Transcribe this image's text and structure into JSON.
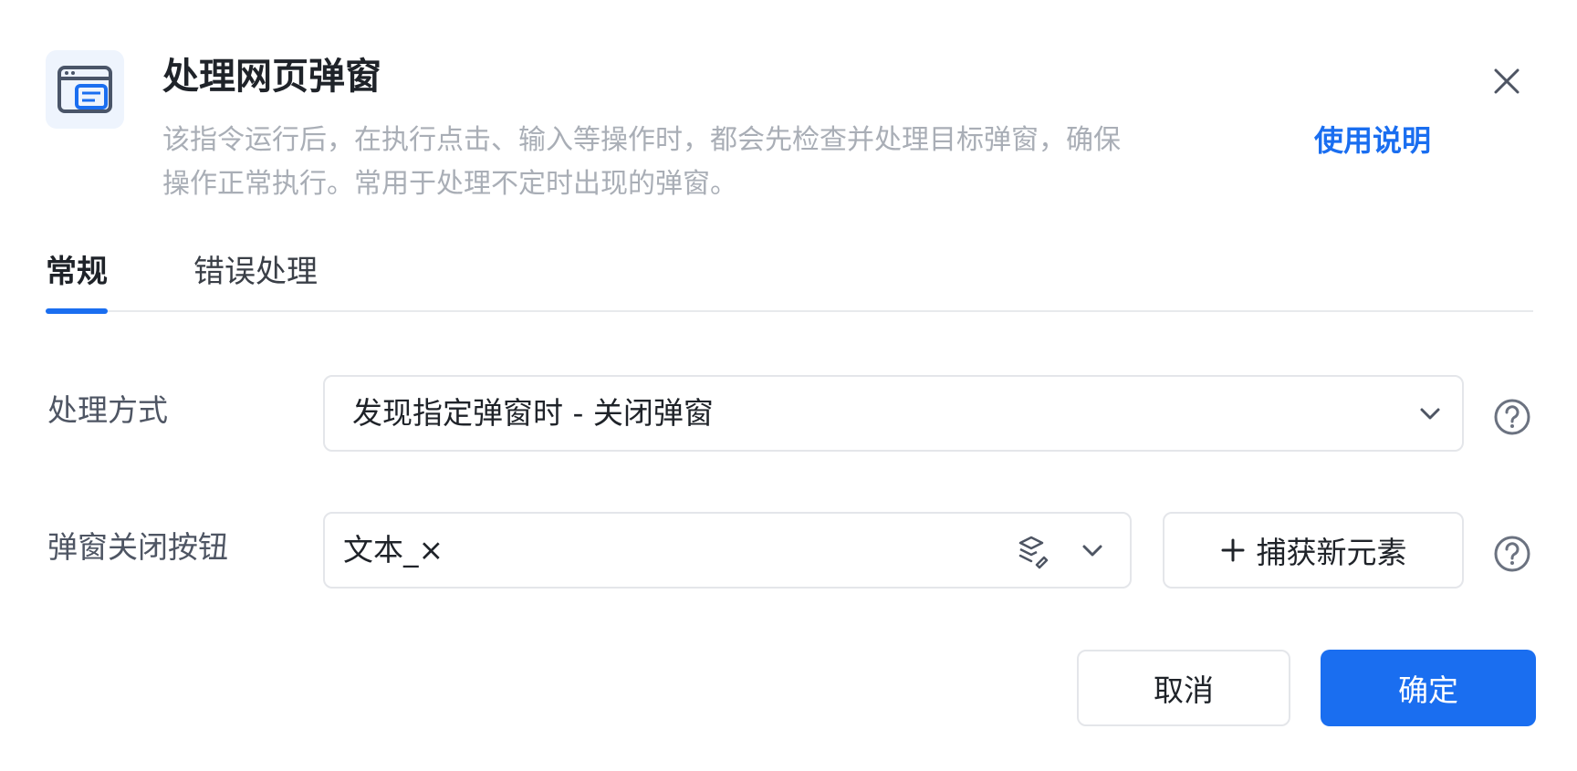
{
  "header": {
    "icon": "browser-popup-icon",
    "title": "处理网页弹窗",
    "description_line1": "该指令运行后，在执行点击、输入等操作时，都会先检查并处理目标弹窗，确保",
    "description_line2": "操作正常执行。常用于处理不定时出现的弹窗。",
    "help_link": "使用说明",
    "close_icon": "close-icon"
  },
  "tabs": [
    {
      "label": "常规",
      "active": true
    },
    {
      "label": "错误处理",
      "active": false
    }
  ],
  "form": {
    "method": {
      "label": "处理方式",
      "value": "发现指定弹窗时 - 关闭弹窗"
    },
    "close_button": {
      "label": "弹窗关闭按钮",
      "value": "文本_×",
      "capture_label": "捕获新元素"
    }
  },
  "footer": {
    "cancel_label": "取消",
    "ok_label": "确定"
  },
  "colors": {
    "accent": "#1a6ef0",
    "muted_text": "#a9aeb6",
    "border": "#e4e6ea"
  }
}
